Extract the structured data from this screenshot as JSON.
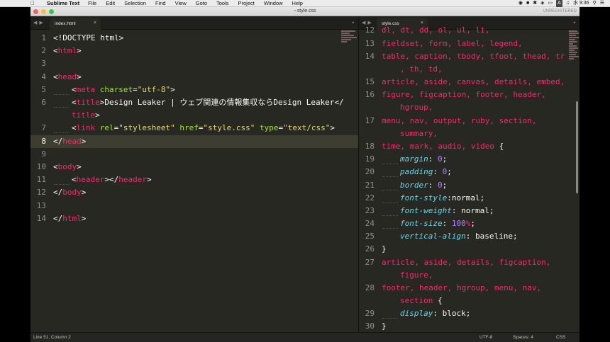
{
  "menubar": {
    "app_name": "Sublime Text",
    "items": [
      "File",
      "Edit",
      "Selection",
      "Find",
      "View",
      "Goto",
      "Tools",
      "Project",
      "Window",
      "Help"
    ],
    "status_letter": "A",
    "clock": "水 9:36"
  },
  "window": {
    "title": "style.css",
    "unregistered": "UNREGISTERED"
  },
  "left_pane": {
    "tab": "index.html",
    "lines": [
      {
        "n": "1"
      },
      {
        "n": "2"
      },
      {
        "n": "3"
      },
      {
        "n": "4"
      },
      {
        "n": "5"
      },
      {
        "n": "6"
      },
      {
        "n": ""
      },
      {
        "n": "7"
      },
      {
        "n": "8"
      },
      {
        "n": "9"
      },
      {
        "n": "10"
      },
      {
        "n": "11"
      },
      {
        "n": "12"
      },
      {
        "n": "13"
      },
      {
        "n": "14"
      }
    ],
    "code": {
      "l1": "<!DOCTYPE html>",
      "l2_open": "<",
      "l2_tag": "html",
      "l2_close": ">",
      "l4_tag": "head",
      "l5_tag": "meta",
      "l5_attr": "charset",
      "l5_val": "\"utf-8\"",
      "l6_tag": "title",
      "l6_text": "Design Leaker | ウェブ関連の情報集収ならDesign Leaker",
      "l6b_tag": "title",
      "l7_tag": "link",
      "l7_attr1": "rel",
      "l7_val1": "\"stylesheet\"",
      "l7_attr2": "href",
      "l7_val2": "\"style.css\"",
      "l7_attr3": "type",
      "l7_val3": "\"text/css\"",
      "l8_tag": "head",
      "l10_tag": "body",
      "l11_tag": "header",
      "l12_tag": "body",
      "l14_tag": "html"
    }
  },
  "right_pane": {
    "tab": "style.css",
    "code": {
      "l12": "dl, dt, dd, ol, ul, li,",
      "l13": "fieldset, form, label, legend,",
      "l14a": "table, caption, tbody, tfoot, thead, tr",
      "l14b": ", th, td,",
      "l15": "article, aside, canvas, details, embed,",
      "l16a": "figure, figcaption, footer, header,",
      "l16b": "hgroup,",
      "l17a": "menu, nav, output, ruby, section,",
      "l17b": "summary,",
      "l18_sel": "time, mark, audio, video",
      "l19_prop": "margin",
      "l19_val": "0",
      "l20_prop": "padding",
      "l20_val": "0",
      "l21_prop": "border",
      "l21_val": "0",
      "l22_prop": "font-style",
      "l22_val": "normal",
      "l23_prop": "font-weight",
      "l23_val": "normal",
      "l24_prop": "font-size",
      "l24_val": "100",
      "l25": "}",
      "l27a": "article, aside, details, figcaption,",
      "l27b": "figure,",
      "l28a": "footer, header, hgroup, menu, nav,",
      "l28b": "section",
      "l29_prop": "display",
      "l29_val": "block",
      "l30": "}"
    },
    "line_numbers": [
      "12",
      "13",
      "14",
      "",
      "15",
      "16",
      "",
      "17",
      "",
      "18",
      "19",
      "20",
      "21",
      "22",
      "23",
      "24",
      "25",
      "26",
      "27",
      "",
      "28",
      "",
      "29",
      "30"
    ]
  },
  "statusbar": {
    "position": "Line 51, Column 2",
    "encoding": "UTF-8",
    "spaces": "Spaces: 4",
    "syntax": "CSS"
  },
  "colors": {
    "editor_bg": "#272822",
    "tag": "#f92672",
    "attr": "#a6e22e",
    "string": "#e6db74",
    "property": "#66d9ef",
    "number": "#ae81ff"
  }
}
